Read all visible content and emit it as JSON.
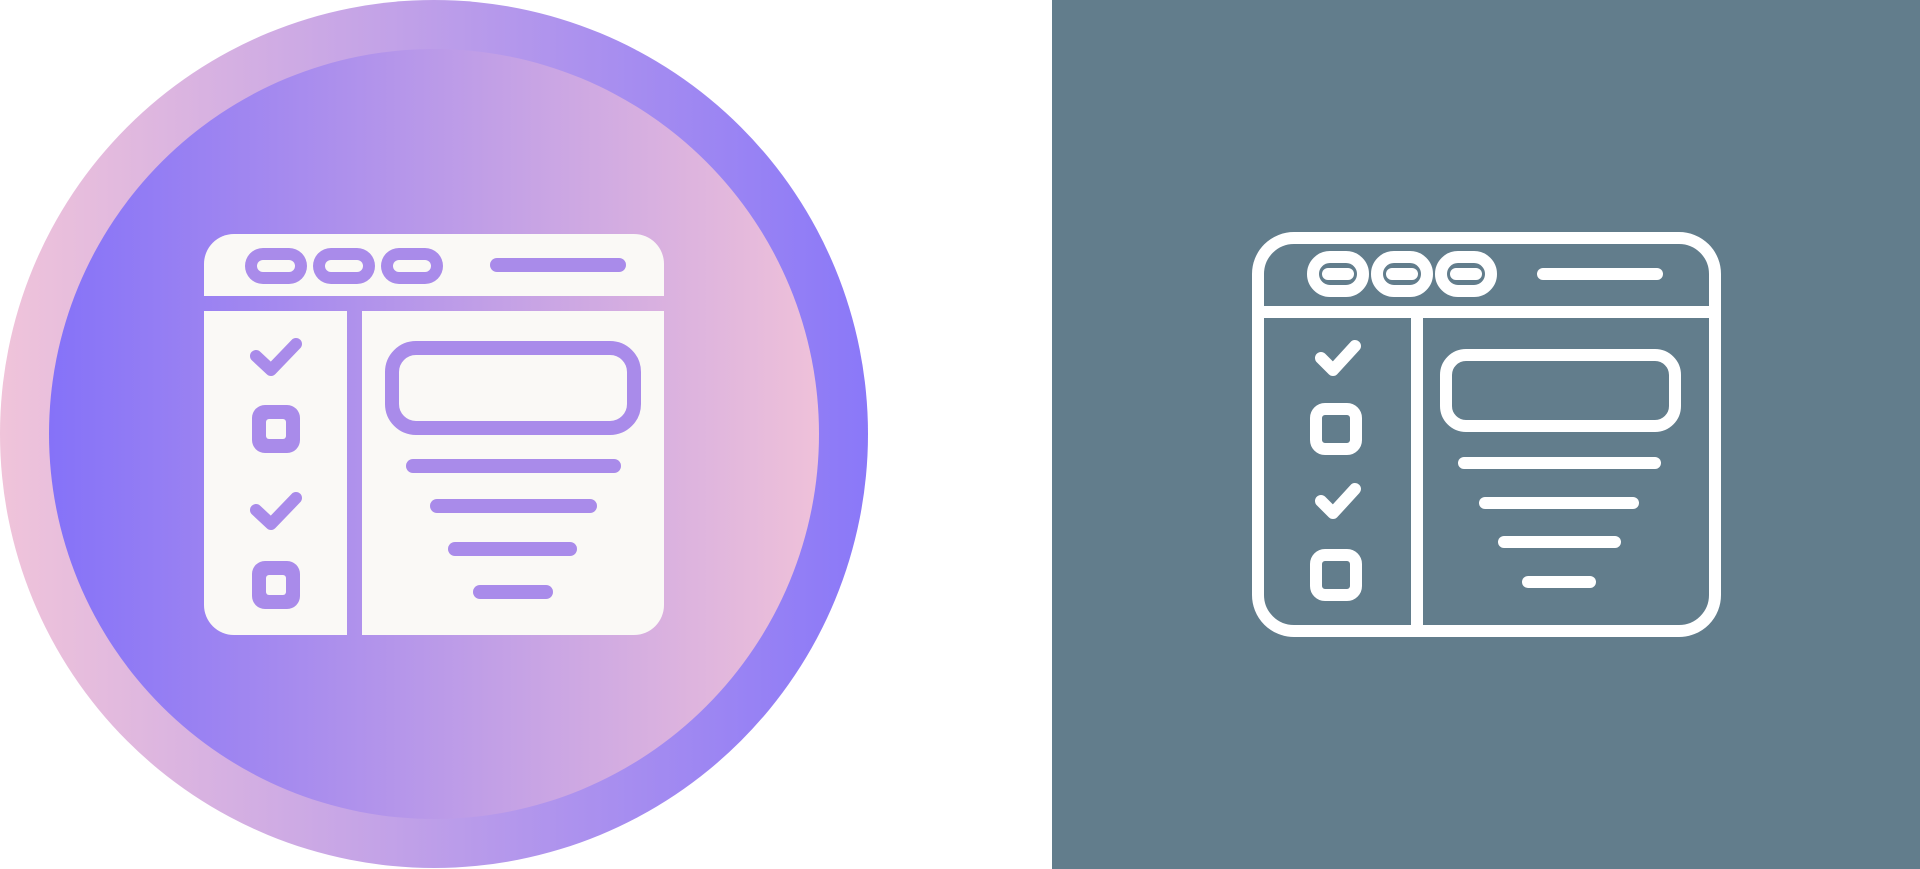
{
  "icons": [
    {
      "name": "checklist-browser-window-icon",
      "style": "glyph",
      "colors": {
        "outer_gradient": [
          "#f0c4da",
          "#8a78f8"
        ],
        "inner_gradient": [
          "#8572f8",
          "#efc1d9"
        ],
        "window_fill": "#faf9f6",
        "accent": "#a98bea"
      },
      "checklist": [
        "checked",
        "unchecked",
        "checked",
        "unchecked"
      ]
    },
    {
      "name": "checklist-browser-window-icon",
      "style": "outline",
      "colors": {
        "background": "#627d8c",
        "stroke": "#ffffff"
      },
      "checklist": [
        "checked",
        "unchecked",
        "checked",
        "unchecked"
      ]
    }
  ]
}
